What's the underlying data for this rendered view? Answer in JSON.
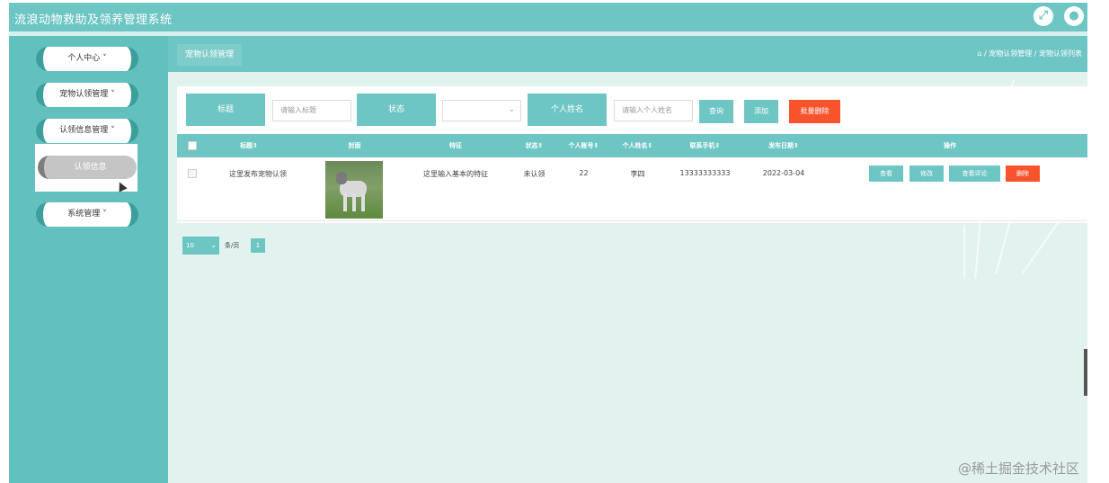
{
  "app": {
    "title": "流浪动物救助及领养管理系统",
    "icons": [
      "fullscreen-icon",
      "user-icon"
    ]
  },
  "sidebar": {
    "items": [
      {
        "label": "个人中心",
        "chevron": "˅"
      },
      {
        "label": "宠物认领管理",
        "chevron": "˅"
      },
      {
        "label": "认领信息管理",
        "chevron": "˅"
      },
      {
        "label": "系统管理",
        "chevron": "˅"
      }
    ],
    "submenu": [
      {
        "label": "认领信息"
      }
    ]
  },
  "header": {
    "tab": "宠物认领管理",
    "breadcrumb": "/ 宠物认领管理 / 宠物认领列表"
  },
  "search": {
    "title_label": "标题",
    "title_placeholder": "请输入标题",
    "status_label": "状态",
    "status_value": "",
    "name_label": "个人姓名",
    "name_placeholder": "请输入个人姓名",
    "query_button": "查询",
    "add_button": "添加",
    "batch_delete_button": "批量删除"
  },
  "table": {
    "columns": [
      "标题⇕",
      "封面",
      "特征",
      "状态⇕",
      "个人账号⇕",
      "个人姓名⇕",
      "联系手机⇕",
      "发布日期⇕",
      "操作"
    ],
    "rows": [
      {
        "title": "这里发布宠物认领",
        "cover": "dog-photo",
        "feature": "这里输入基本的特征",
        "status": "未认领",
        "account": "22",
        "name": "李四",
        "phone": "13333333333",
        "date": "2022-03-04",
        "actions": [
          "查看",
          "修改",
          "查看评论",
          "删除"
        ]
      }
    ]
  },
  "pagination": {
    "page_size": "10",
    "page_size_label": "条/页",
    "current_page": "1"
  },
  "watermark": "@稀土掘金技术社区",
  "colors": {
    "accent": "#6ec6c4",
    "sidebar": "#62c1bf",
    "danger": "#f7542e",
    "background": "#e2f2ef"
  }
}
